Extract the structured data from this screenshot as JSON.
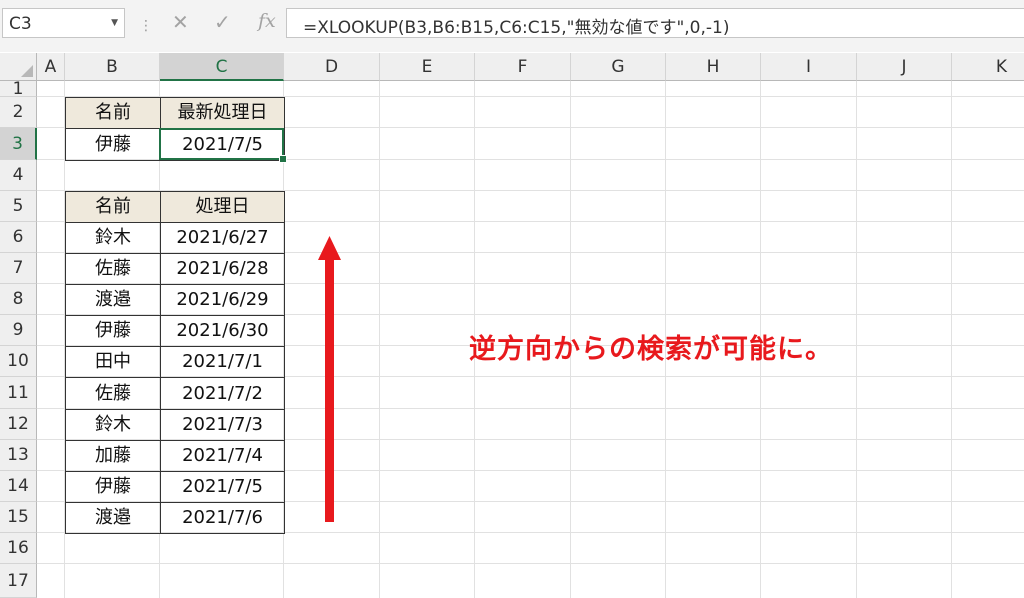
{
  "formula_bar": {
    "name_box": "C3",
    "cancel_glyph": "✕",
    "enter_glyph": "✓",
    "fx_glyph": "fx",
    "formula": "=XLOOKUP(B3,B6:B15,C6:C15,\"無効な値です\",0,-1)"
  },
  "columns": [
    "A",
    "B",
    "C",
    "D",
    "E",
    "F",
    "G",
    "H",
    "I",
    "J",
    "K"
  ],
  "selected_column": "C",
  "rows": [
    "1",
    "2",
    "3",
    "4",
    "5",
    "6",
    "7",
    "8",
    "9",
    "10",
    "11",
    "12",
    "13",
    "14",
    "15",
    "16",
    "17"
  ],
  "selected_row": "3",
  "lookup_table": {
    "header": [
      "名前",
      "最新処理日"
    ],
    "row": [
      "伊藤",
      "2021/7/5"
    ]
  },
  "data_table": {
    "header": [
      "名前",
      "処理日"
    ],
    "rows": [
      [
        "鈴木",
        "2021/6/27"
      ],
      [
        "佐藤",
        "2021/6/28"
      ],
      [
        "渡邉",
        "2021/6/29"
      ],
      [
        "伊藤",
        "2021/6/30"
      ],
      [
        "田中",
        "2021/7/1"
      ],
      [
        "佐藤",
        "2021/7/2"
      ],
      [
        "鈴木",
        "2021/7/3"
      ],
      [
        "加藤",
        "2021/7/4"
      ],
      [
        "伊藤",
        "2021/7/5"
      ],
      [
        "渡邉",
        "2021/7/6"
      ]
    ]
  },
  "annotation": "逆方向からの検索が可能に。",
  "colors": {
    "accent_green": "#217346",
    "arrow_red": "#e8191d",
    "table_header_fill": "#efe9dc"
  },
  "icons": {
    "arrow": "up-arrow-icon"
  }
}
